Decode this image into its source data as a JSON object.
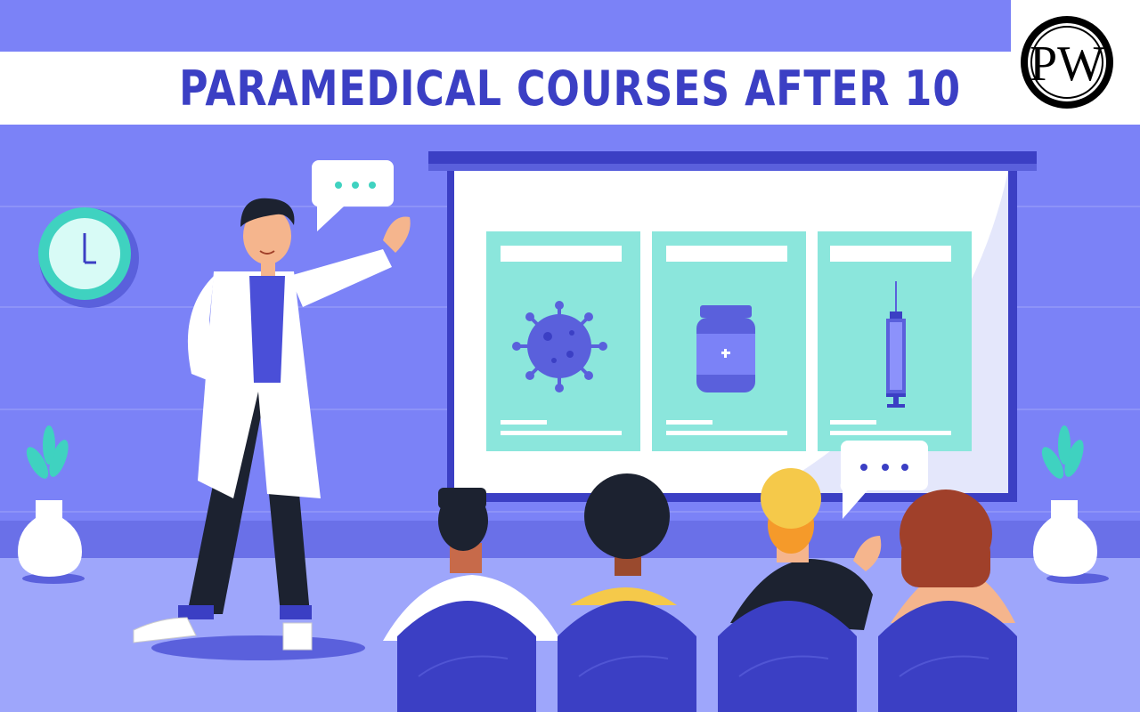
{
  "banner": {
    "title": "PARAMEDICAL COURSES AFTER 10"
  },
  "logo": {
    "letters": "PW"
  },
  "scene": {
    "icons": [
      "clock-icon",
      "virus-icon",
      "medicine-bottle-icon",
      "syringe-icon",
      "plant-icon",
      "speech-bubble-icon"
    ],
    "colors": {
      "background": "#7b82f7",
      "accent": "#3b3fc4",
      "panel": "#8be6dc",
      "wall_dark": "#6b72ec"
    }
  }
}
